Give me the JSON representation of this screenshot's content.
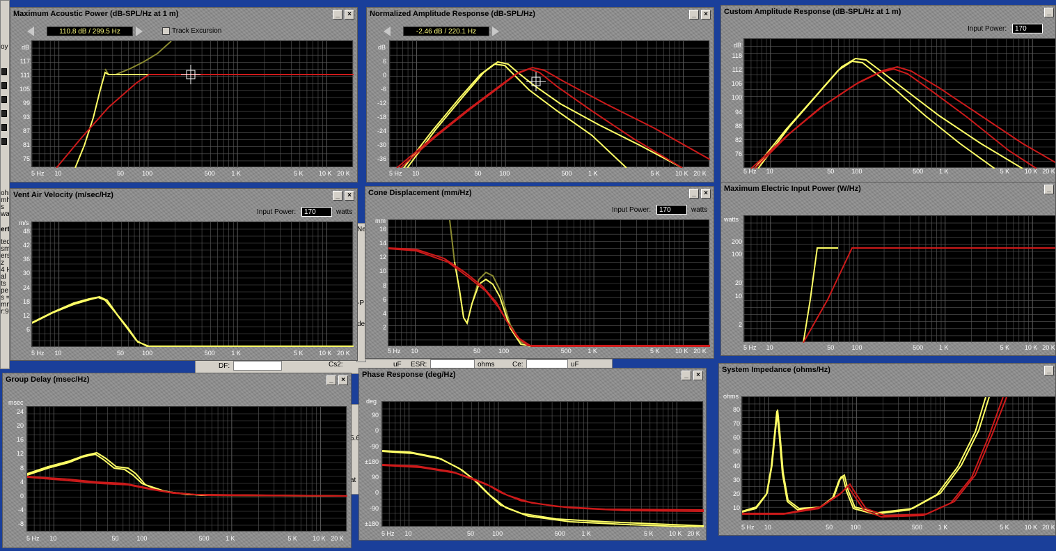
{
  "background": {
    "left_fragments": [
      "ohms",
      "mh",
      "s",
      "wa",
      "erti",
      "ted",
      "sm",
      "ers",
      "z",
      "4 H",
      "al",
      "ts",
      "pe",
      "s =",
      "mm",
      "r:9"
    ],
    "left_top_fragment": "oy",
    "mid_labels": {
      "df": "DF:",
      "cs2": "Cs2:",
      "uf1": "uF",
      "esr": "ESR:",
      "ohms": "ohms",
      "ce": "Ce:",
      "uf2": "uF"
    },
    "mid_fragments": [
      "Ne",
      "-P",
      "de",
      "5.6",
      "at"
    ]
  },
  "xticks_full": [
    "5 Hz",
    "10",
    "50",
    "100",
    "500",
    "1 K",
    "5 K",
    "10 K",
    "20 K"
  ],
  "windows": {
    "max_acoustic": {
      "title": "Maximum Acoustic Power (dB-SPL/Hz at 1 m)",
      "readout": "110.8 dB / 299.5 Hz",
      "track_label": "Track Excursion",
      "unit": "dB",
      "yticks": [
        "117",
        "111",
        "105",
        "99",
        "93",
        "87",
        "81",
        "75"
      ]
    },
    "normalized": {
      "title": "Normalized Amplitude Response (dB-SPL/Hz)",
      "readout": "-2.46 dB / 220.1 Hz",
      "unit": "dB",
      "yticks": [
        "6",
        "0",
        "-6",
        "-12",
        "-18",
        "-24",
        "-30",
        "-36"
      ]
    },
    "custom": {
      "title": "Custom Amplitude Response (dB-SPL/Hz at 1 m)",
      "power_label": "Input Power:",
      "power_value": "170",
      "unit": "dB",
      "yticks": [
        "118",
        "112",
        "106",
        "100",
        "94",
        "88",
        "82",
        "76"
      ]
    },
    "vent": {
      "title": "Vent Air Velocity (m/sec/Hz)",
      "power_label": "Input Power:",
      "power_value": "170",
      "watts": "watts",
      "unit": "m/s",
      "yticks": [
        "48",
        "42",
        "36",
        "30",
        "24",
        "18",
        "12",
        "6"
      ]
    },
    "cone": {
      "title": "Cone Displacement (mm/Hz)",
      "power_label": "Input Power:",
      "power_value": "170",
      "watts": "watts",
      "unit": "mm",
      "yticks": [
        "16",
        "14",
        "12",
        "10",
        "8",
        "6",
        "4",
        "2"
      ]
    },
    "max_electric": {
      "title": "Maximum Electric Input Power (W/Hz)",
      "unit": "watts",
      "yticks": [
        "200",
        "100",
        "20",
        "10",
        "2"
      ]
    },
    "group_delay": {
      "title": "Group Delay (msec/Hz)",
      "unit": "msec",
      "yticks": [
        "24",
        "20",
        "16",
        "12",
        "8",
        "4",
        "0",
        "-4",
        "-8"
      ]
    },
    "phase": {
      "title": "Phase Response (deg/Hz)",
      "unit": "deg",
      "yticks": [
        "90",
        "0",
        "-90",
        "±180",
        "90",
        "0",
        "-90",
        "±180"
      ]
    },
    "impedance": {
      "title": "System Impedance (ohms/Hz)",
      "unit": "ohms",
      "yticks": [
        "80",
        "70",
        "60",
        "50",
        "40",
        "30",
        "20",
        "10"
      ]
    }
  },
  "colors": {
    "trace_yellow": "#ffff66",
    "trace_red": "#cc1a1a",
    "trace_olive": "#8a8a30",
    "grid": "#5a5a5a"
  }
}
